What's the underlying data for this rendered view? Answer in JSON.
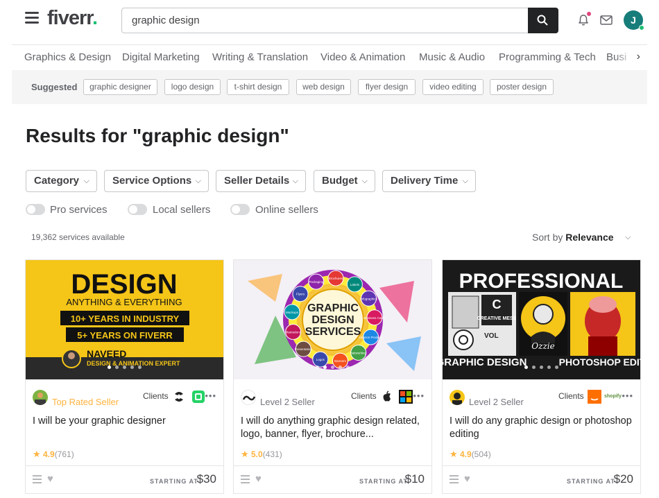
{
  "header": {
    "logo_text": "fiverr",
    "logo_dot": ".",
    "search_value": "graphic design",
    "avatar_initial": "J"
  },
  "categories": [
    "Graphics & Design",
    "Digital Marketing",
    "Writing & Translation",
    "Video & Animation",
    "Music & Audio",
    "Programming & Tech",
    "Busi"
  ],
  "suggested": {
    "label": "Suggested",
    "chips": [
      "graphic designer",
      "logo design",
      "t-shirt design",
      "web design",
      "flyer design",
      "video editing",
      "poster design"
    ]
  },
  "results": {
    "title": "Results for \"graphic design\"",
    "filters": [
      "Category",
      "Service Options",
      "Seller Details",
      "Budget",
      "Delivery Time"
    ],
    "toggles": [
      "Pro services",
      "Local sellers",
      "Online sellers"
    ],
    "count": "19,362 services available",
    "sort_prefix": "Sort by",
    "sort_value": "Relevance"
  },
  "cards": [
    {
      "thumb": {
        "headline": "DESIGN",
        "sub": "ANYTHING & EVERYTHING",
        "box1": "10+ YEARS IN INDUSTRY",
        "box2": "5+ YEARS ON FIVERR",
        "name": "NAVEED",
        "role": "DESIGN & ANIMATION EXPERT"
      },
      "seller_level": "Top Rated Seller",
      "clients_label": "Clients",
      "title": "I will be your graphic designer",
      "rating": "4.9",
      "reviews": "(761)",
      "starting_label": "STARTING AT",
      "price": "$30"
    },
    {
      "thumb": {
        "line1": "GRAPHIC",
        "line2": "DESIGN",
        "line3": "SERVICES",
        "bubbles": [
          "Flyers",
          "Packaging",
          "Brochures",
          "Labels",
          "Infographics",
          "Business Cards",
          "Amazon Products",
          "Networking",
          "Banners",
          "Logos",
          "Presentation",
          "Illustrations",
          "Mockups"
        ]
      },
      "seller_level": "Level 2 Seller",
      "clients_label": "Clients",
      "title": "I will do anything graphic design related, logo, banner, flyer, brochure...",
      "rating": "5.0",
      "reviews": "(431)",
      "starting_label": "STARTING AT",
      "price": "$10"
    },
    {
      "thumb": {
        "headline": "PROFESSIONAL",
        "left_label": "GRAPHIC DESIGN",
        "right_label": "PHOTOSHOP EDIT",
        "collage_c": "C",
        "collage_text": "CREATIVE MESS",
        "collage_vol": "VOL"
      },
      "seller_level": "Level 2 Seller",
      "clients_label": "Clients",
      "client_badge": "shopify",
      "title": "I will do any graphic design or photoshop editing",
      "rating": "4.9",
      "reviews": "(504)",
      "starting_label": "STARTING AT",
      "price": "$20"
    }
  ],
  "colors": {
    "brand_green": "#1dbf73",
    "rating_gold": "#ffb33e",
    "text_dark": "#222325",
    "thumb1_yellow": "#f5c518",
    "avatar_teal": "#177d7a"
  }
}
